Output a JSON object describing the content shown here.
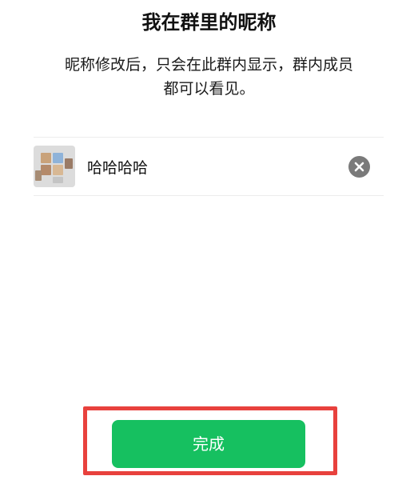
{
  "header": {
    "title": "我在群里的昵称"
  },
  "description": {
    "line1": "昵称修改后，只会在此群内显示，群内成员",
    "line2": "都可以看见。"
  },
  "nickname": {
    "value": "哈哈哈哈"
  },
  "avatar": {
    "icon": "group-avatar-icon"
  },
  "clear": {
    "icon": "clear-x-icon"
  },
  "footer": {
    "done_label": "完成"
  },
  "colors": {
    "accent": "#16c060",
    "highlight_border": "#e8413d",
    "clear_button": "#7a7a7a"
  }
}
